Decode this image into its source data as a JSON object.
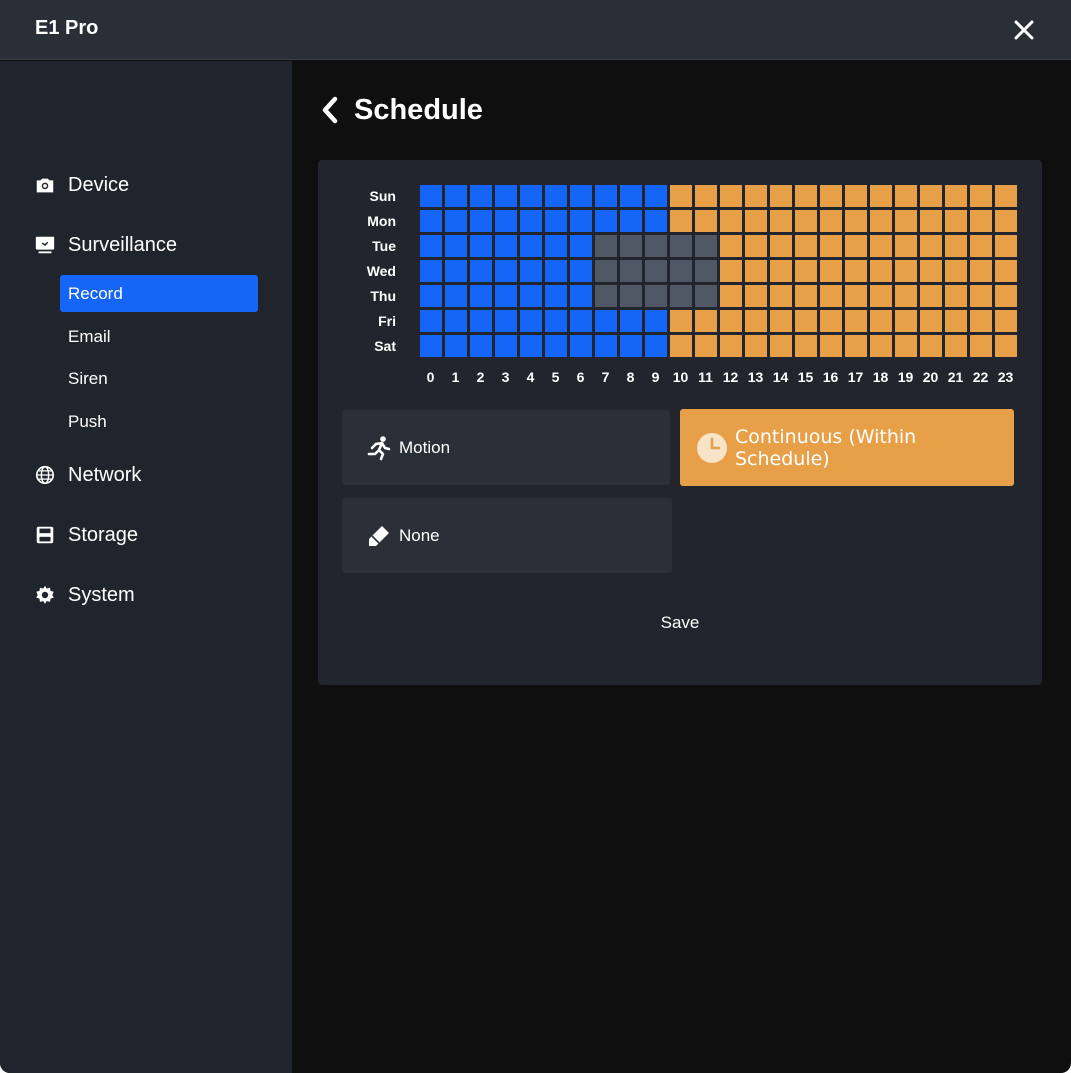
{
  "window": {
    "title": "E1 Pro"
  },
  "sidebar": {
    "items": [
      {
        "label": "Device",
        "icon": "camera-icon"
      },
      {
        "label": "Surveillance",
        "icon": "monitor-icon"
      },
      {
        "label": "Network",
        "icon": "globe-icon"
      },
      {
        "label": "Storage",
        "icon": "floppy-disk-icon"
      },
      {
        "label": "System",
        "icon": "gear-icon"
      }
    ],
    "surveillance_sub": [
      {
        "label": "Record",
        "active": true
      },
      {
        "label": "Email",
        "active": false
      },
      {
        "label": "Siren",
        "active": false
      },
      {
        "label": "Push",
        "active": false
      }
    ]
  },
  "page": {
    "title": "Schedule"
  },
  "schedule": {
    "days": [
      "Sun",
      "Mon",
      "Tue",
      "Wed",
      "Thu",
      "Fri",
      "Sat"
    ],
    "hours": [
      "0",
      "1",
      "2",
      "3",
      "4",
      "5",
      "6",
      "7",
      "8",
      "9",
      "10",
      "11",
      "12",
      "13",
      "14",
      "15",
      "16",
      "17",
      "18",
      "19",
      "20",
      "21",
      "22",
      "23"
    ],
    "legend": {
      "M": "Motion",
      "C": "Continuous",
      "N": "None"
    },
    "rows": [
      "MMMMMMMMMMCCCCCCCCCCCCCC",
      "MMMMMMMMMMCCCCCCCCCCCCCC",
      "MMMMMMMNNNNNCCCCCCCCCCCC",
      "MMMMMMMNNNNNCCCCCCCCCCCC",
      "MMMMMMMNNNNNCCCCCCCCCCCC",
      "MMMMMMMMMMCCCCCCCCCCCCCC",
      "MMMMMMMMMMCCCCCCCCCCCCCC"
    ]
  },
  "colors": {
    "motion": "#1565f6",
    "continuous": "#e8a048",
    "none": "#505866"
  },
  "modes": {
    "motion": {
      "label": "Motion",
      "icon": "running-person-icon"
    },
    "continuous": {
      "label": "Continuous (Within Schedule)",
      "icon": "clock-icon",
      "selected": true
    },
    "none": {
      "label": "None",
      "icon": "eraser-icon"
    }
  },
  "actions": {
    "save_label": "Save"
  }
}
